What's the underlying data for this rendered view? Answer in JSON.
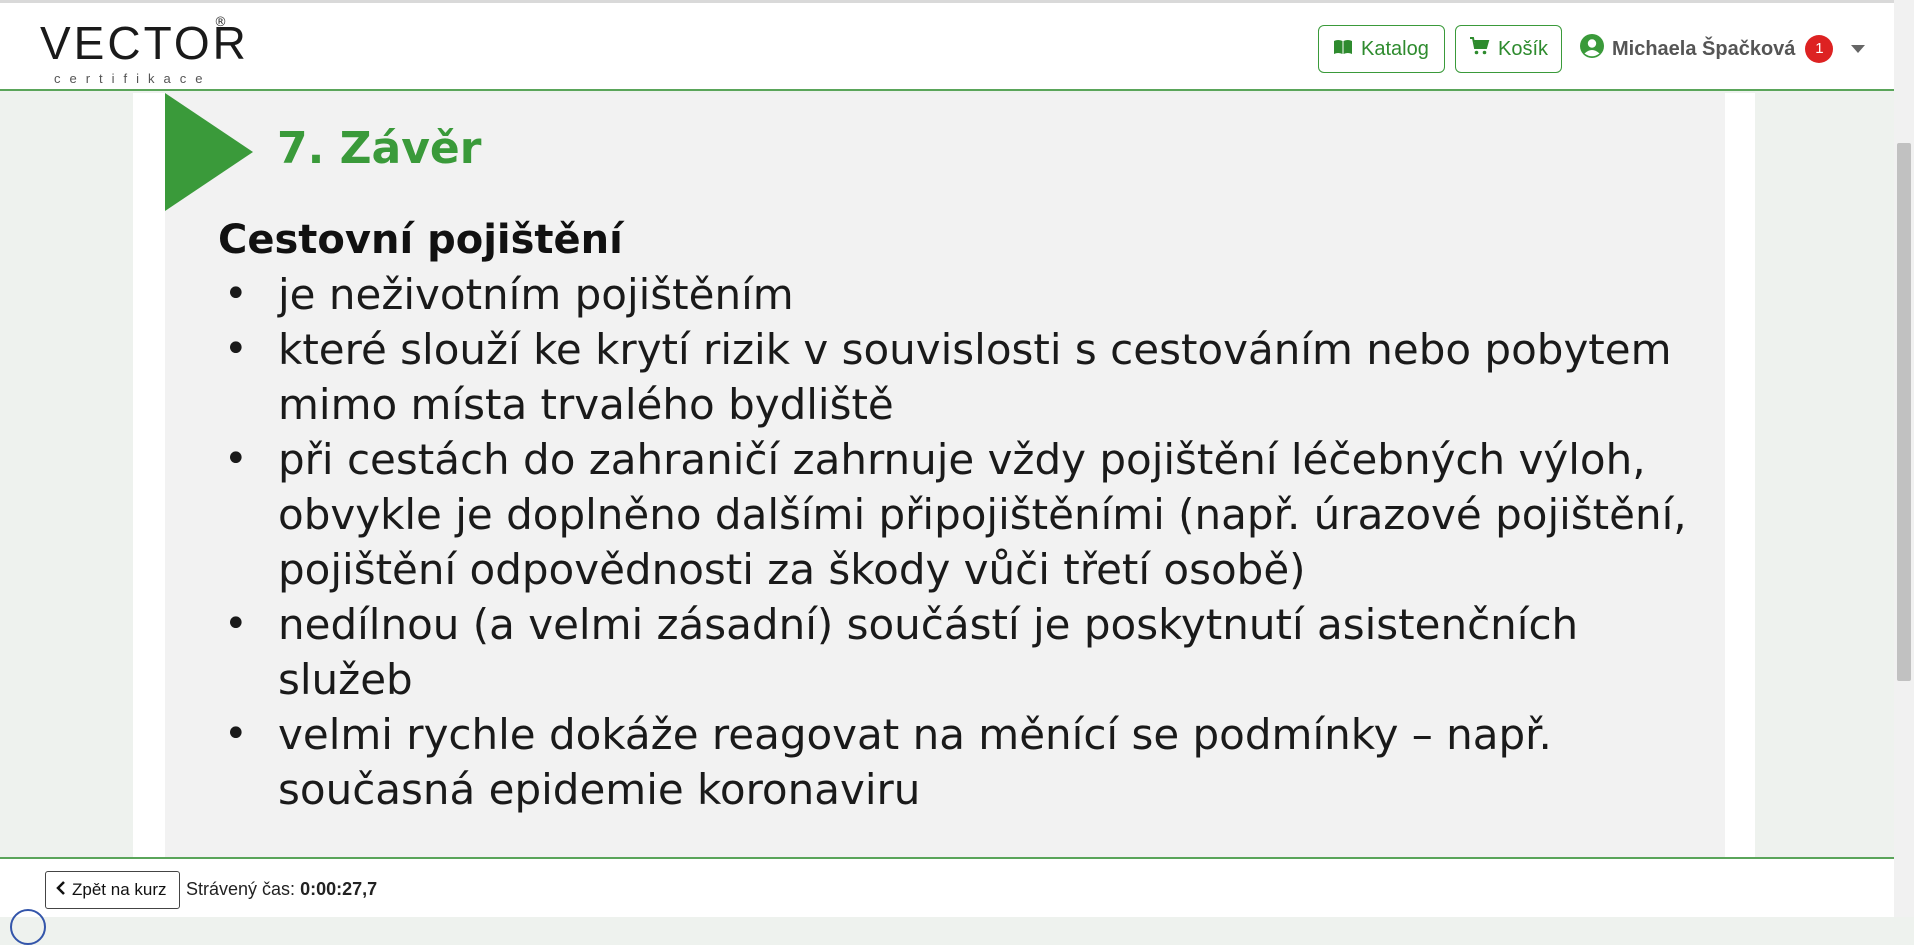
{
  "header": {
    "logo_text": "VECTOR",
    "logo_reg": "®",
    "logo_sub": "certifikace",
    "katalog_label": "Katalog",
    "kosik_label": "Košík",
    "user_name": "Michaela Špačková",
    "notification_count": "1"
  },
  "slide": {
    "title": "7. Závěr",
    "heading": "Cestovní pojištění",
    "bullets": [
      "je neživotním pojištěním",
      "které slouží ke krytí rizik v souvislosti s cestováním nebo pobytem mimo místa trvalého bydliště",
      "při cestách do zahraničí zahrnuje vždy pojištění léčebných výloh, obvykle je doplněno dalšími připojištěními (např. úrazové pojištění, pojištění odpovědnosti za škody vůči třetí osobě)",
      "nedílnou (a velmi zásadní) součástí je poskytnutí asistenčních služeb",
      "velmi rychle dokáže reagovat na měnící se podmínky – např. současná epidemie koronaviru"
    ]
  },
  "footer": {
    "back_label": "Zpět na kurz",
    "time_label": "Strávený čas:",
    "time_value": "0:00:27,7"
  },
  "colors": {
    "accent": "#3a9a3a",
    "badge": "#dd2222"
  }
}
